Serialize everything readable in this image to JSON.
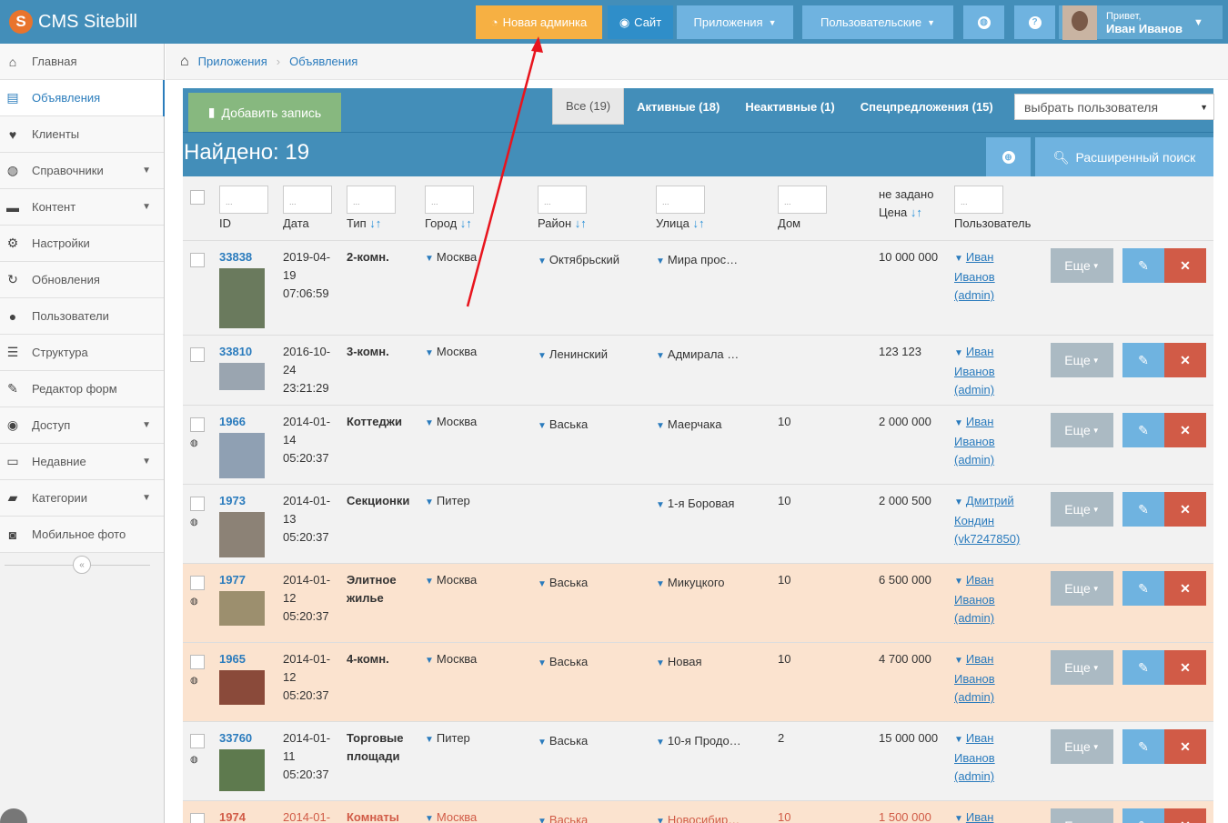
{
  "brand": "CMS Sitebill",
  "topbar": {
    "new_admin": "Новая админка",
    "site": "Сайт",
    "apps": "Приложения",
    "user_menu": "Пользовательские",
    "greeting": "Привет,",
    "user_name": "Иван Иванов"
  },
  "sidebar": {
    "items": [
      {
        "label": "Главная",
        "icon": "home-icon"
      },
      {
        "label": "Объявления",
        "icon": "book-icon",
        "active": true
      },
      {
        "label": "Клиенты",
        "icon": "heart-icon"
      },
      {
        "label": "Справочники",
        "icon": "globe-icon",
        "sub": true
      },
      {
        "label": "Контент",
        "icon": "coffee-icon",
        "sub": true
      },
      {
        "label": "Настройки",
        "icon": "cog-icon"
      },
      {
        "label": "Обновления",
        "icon": "refresh-icon"
      },
      {
        "label": "Пользователи",
        "icon": "user-icon"
      },
      {
        "label": "Структура",
        "icon": "list-icon"
      },
      {
        "label": "Редактор форм",
        "icon": "edit-icon"
      },
      {
        "label": "Доступ",
        "icon": "users-icon",
        "sub": true
      },
      {
        "label": "Недавние",
        "icon": "monitor-icon",
        "sub": true
      },
      {
        "label": "Категории",
        "icon": "folder-icon",
        "sub": true
      },
      {
        "label": "Мобильное фото",
        "icon": "camera-icon"
      }
    ]
  },
  "breadcrumb": {
    "first": "Приложения",
    "second": "Объявления"
  },
  "toolbar": {
    "add": "Добавить запись",
    "tabs": [
      "Все (19)",
      "Активные (18)",
      "Неактивные (1)",
      "Спецпредложения (15)"
    ],
    "user_select": "выбрать пользователя"
  },
  "found": "Найдено: 19",
  "adv_search": "Расширенный поиск",
  "headers": {
    "id": "ID",
    "date": "Дата",
    "type": "Тип",
    "city": "Город",
    "district": "Район",
    "street": "Улица",
    "house": "Дом",
    "price_top": "не задано",
    "price": "Цена",
    "user": "Пользователь",
    "filter_placeholder": "..."
  },
  "buttons": {
    "more": "Еще"
  },
  "rows": [
    {
      "id": "33838",
      "date": [
        "2019-04-",
        "19",
        "07:06:59"
      ],
      "type": [
        "2-комн."
      ],
      "city": "Москва",
      "district": "Октябрьский",
      "street": "Мира прос…",
      "house": "",
      "price": "10 000 000",
      "user": [
        "Иван",
        "Иванов",
        "(admin)"
      ],
      "globe": false
    },
    {
      "id": "33810",
      "date": [
        "2016-10-",
        "24",
        "23:21:29"
      ],
      "type": [
        "3-комн."
      ],
      "city": "Москва",
      "district": "Ленинский",
      "street": "Адмирала …",
      "house": "",
      "price": "123 123",
      "user": [
        "Иван",
        "Иванов",
        "(admin)"
      ],
      "globe": false
    },
    {
      "id": "1966",
      "date": [
        "2014-01-",
        "14",
        "05:20:37"
      ],
      "type": [
        "Коттеджи"
      ],
      "city": "Москва",
      "district": "Васька",
      "street": "Маерчака",
      "house": "10",
      "price": "2 000 000",
      "user": [
        "Иван",
        "Иванов",
        "(admin)"
      ],
      "globe": true
    },
    {
      "id": "1973",
      "date": [
        "2014-01-",
        "13",
        "05:20:37"
      ],
      "type": [
        "Секционки"
      ],
      "city": "Питер",
      "district": "",
      "street": "1-я Боровая",
      "house": "10",
      "price": "2 000 500",
      "user": [
        "Дмитрий",
        "Кондин",
        "(vk7247850)"
      ],
      "globe": true
    },
    {
      "id": "1977",
      "date": [
        "2014-01-",
        "12",
        "05:20:37"
      ],
      "type": [
        "Элитное",
        "жилье"
      ],
      "city": "Москва",
      "district": "Васька",
      "street": "Микуцкого",
      "house": "10",
      "price": "6 500 000",
      "user": [
        "Иван",
        "Иванов",
        "(admin)"
      ],
      "globe": true,
      "highlight": true
    },
    {
      "id": "1965",
      "date": [
        "2014-01-",
        "12",
        "05:20:37"
      ],
      "type": [
        "4-комн."
      ],
      "city": "Москва",
      "district": "Васька",
      "street": "Новая",
      "house": "10",
      "price": "4 700 000",
      "user": [
        "Иван",
        "Иванов",
        "(admin)"
      ],
      "globe": true,
      "highlight": true
    },
    {
      "id": "33760",
      "date": [
        "2014-01-",
        "11",
        "05:20:37"
      ],
      "type": [
        "Торговые",
        "площади"
      ],
      "city": "Питер",
      "district": "Васька",
      "street": "10-я Продо…",
      "house": "2",
      "price": "15 000 000",
      "user": [
        "Иван",
        "Иванов",
        "(admin)"
      ],
      "globe": true
    },
    {
      "id": "1974",
      "date": [
        "2014-01-"
      ],
      "type": [
        "Комнаты"
      ],
      "city": "Москва",
      "district": "Васька",
      "street": "Новосибир…",
      "house": "10",
      "price": "1 500 000",
      "user": [
        "Иван"
      ],
      "globe": false,
      "highlight": true,
      "red": true
    }
  ]
}
